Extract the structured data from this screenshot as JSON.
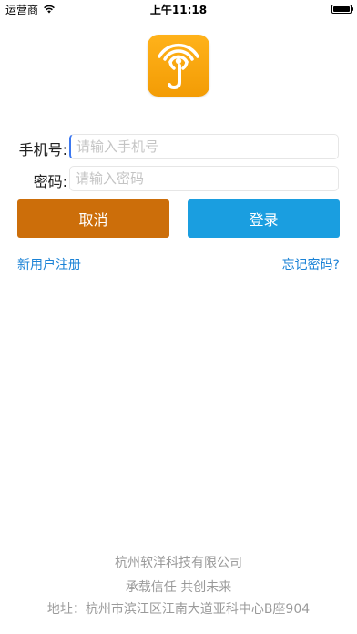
{
  "status_bar": {
    "carrier": "运营商",
    "time": "上午11:18",
    "wifi_icon": "wifi-icon",
    "battery_icon": "battery-icon"
  },
  "logo": {
    "icon": "signal-broadcast-j-logo",
    "colors": {
      "gradient_top": "#ffb21a",
      "gradient_bottom": "#f39c05",
      "mark": "#ffffff"
    }
  },
  "form": {
    "phone_label": "手机号:",
    "phone_placeholder": "请输入手机号",
    "phone_value": "",
    "password_label": "密码:",
    "password_placeholder": "请输入密码",
    "password_value": ""
  },
  "buttons": {
    "cancel_label": "取消",
    "login_label": "登录",
    "colors": {
      "cancel": "#cc6e0a",
      "login": "#1a9ee0"
    }
  },
  "links": {
    "register": "新用户注册",
    "forgot_password": "忘记密码?",
    "color": "#1a82d6"
  },
  "footer": {
    "company": "杭州软洋科技有限公司",
    "slogan": "承载信任 共创未来",
    "address": "地址：杭州市滨江区江南大道亚科中心B座904"
  }
}
